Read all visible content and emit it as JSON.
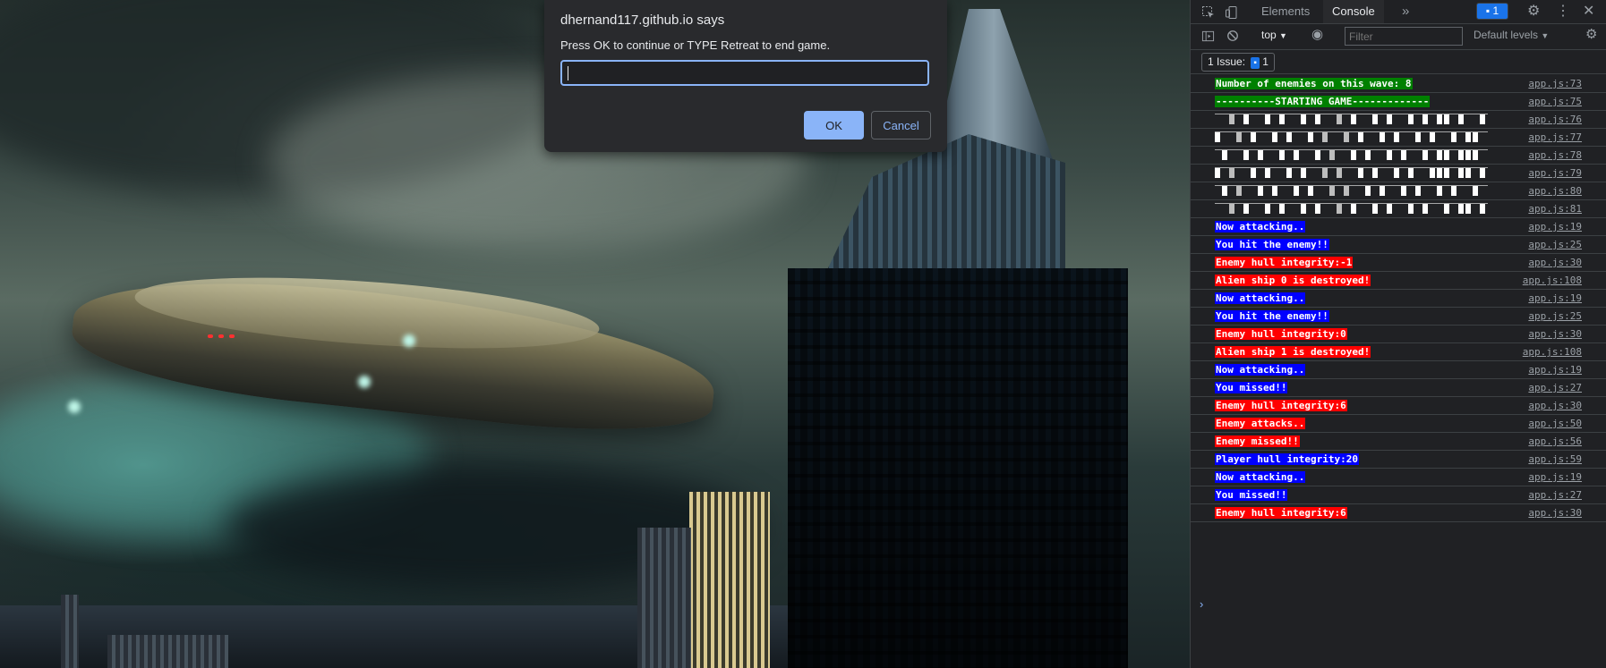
{
  "dialog": {
    "origin": "dhernand117.github.io says",
    "message": "Press OK to continue or TYPE Retreat to end game.",
    "input_value": "",
    "ok_label": "OK",
    "cancel_label": "Cancel"
  },
  "devtools": {
    "tabs": [
      {
        "label": "Elements",
        "active": false
      },
      {
        "label": "Console",
        "active": true
      }
    ],
    "more_tabs_icon": "chevron-double-right-icon",
    "badge_count": "1",
    "context": "top",
    "filter_placeholder": "Filter",
    "levels": "Default levels",
    "issues_label": "1 Issue:",
    "issues_count": "1",
    "console_rows": [
      {
        "text": "Number of enemies on this wave: 8",
        "style": "green",
        "src": "app.js:73"
      },
      {
        "text": "----------STARTING GAME-------------",
        "style": "green",
        "src": "app.js:75"
      },
      {
        "text": "",
        "style": "art",
        "src": "app.js:76"
      },
      {
        "text": "",
        "style": "art",
        "src": "app.js:77"
      },
      {
        "text": "",
        "style": "art",
        "src": "app.js:78"
      },
      {
        "text": "",
        "style": "art",
        "src": "app.js:79"
      },
      {
        "text": "",
        "style": "art",
        "src": "app.js:80"
      },
      {
        "text": "",
        "style": "art",
        "src": "app.js:81"
      },
      {
        "text": "Now attacking..",
        "style": "blue",
        "src": "app.js:19"
      },
      {
        "text": "You hit the enemy!!",
        "style": "blue",
        "src": "app.js:25"
      },
      {
        "text": "Enemy hull integrity:-1",
        "style": "red",
        "src": "app.js:30"
      },
      {
        "text": "Alien ship 0 is destroyed!",
        "style": "red",
        "src": "app.js:108"
      },
      {
        "text": "Now attacking..",
        "style": "blue",
        "src": "app.js:19"
      },
      {
        "text": "You hit the enemy!!",
        "style": "blue",
        "src": "app.js:25"
      },
      {
        "text": "Enemy hull integrity:0",
        "style": "red",
        "src": "app.js:30"
      },
      {
        "text": "Alien ship 1 is destroyed!",
        "style": "red",
        "src": "app.js:108"
      },
      {
        "text": "Now attacking..",
        "style": "blue",
        "src": "app.js:19"
      },
      {
        "text": "You missed!!",
        "style": "blue",
        "src": "app.js:27"
      },
      {
        "text": "Enemy hull integrity:6",
        "style": "red",
        "src": "app.js:30"
      },
      {
        "text": "Enemy attacks..",
        "style": "red",
        "src": "app.js:50"
      },
      {
        "text": "Enemy missed!!",
        "style": "red",
        "src": "app.js:56"
      },
      {
        "text": "Player hull integrity:20",
        "style": "blue",
        "src": "app.js:59"
      },
      {
        "text": "Now attacking..",
        "style": "blue",
        "src": "app.js:19"
      },
      {
        "text": "You missed!!",
        "style": "blue",
        "src": "app.js:27"
      },
      {
        "text": "Enemy hull integrity:6",
        "style": "red",
        "src": "app.js:30"
      }
    ],
    "prompt_symbol": "›"
  }
}
